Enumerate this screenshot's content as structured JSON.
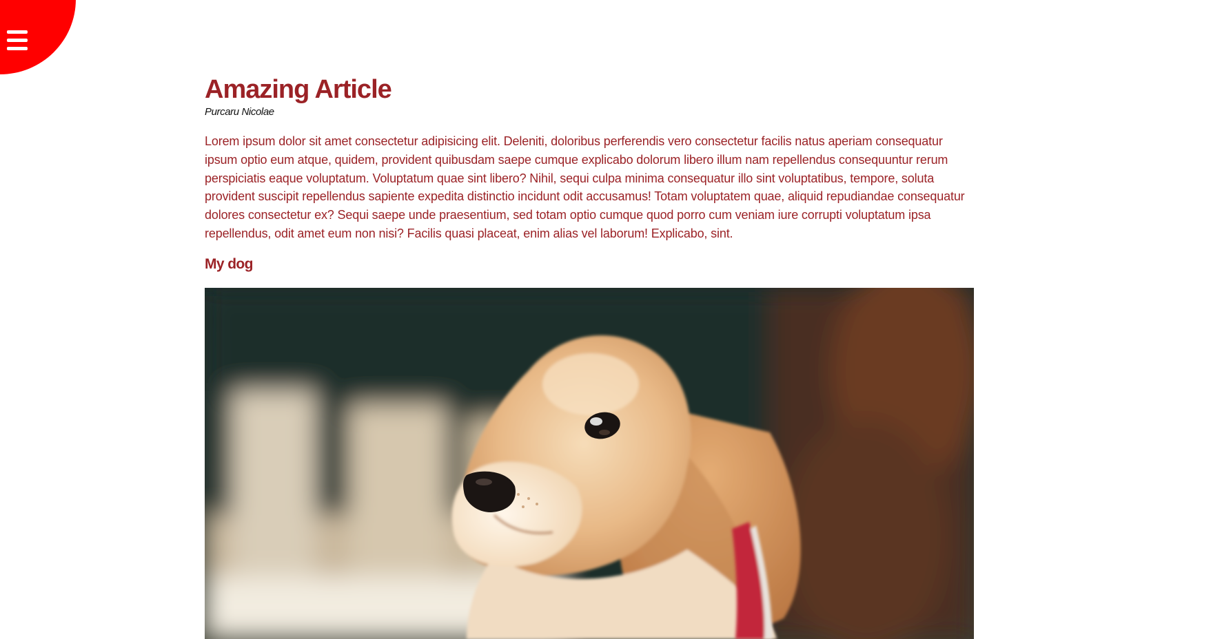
{
  "nav": {
    "menu_icon": "hamburger-menu-icon",
    "accent_color": "#ff0000"
  },
  "article": {
    "title": "Amazing Article",
    "author": "Purcaru Nicolae",
    "body": "Lorem ipsum dolor sit amet consectetur adipisicing elit. Deleniti, doloribus perferendis vero consectetur facilis natus aperiam consequatur ipsum optio eum atque, quidem, provident quibusdam saepe cumque explicabo dolorum libero illum nam repellendus consequuntur rerum perspiciatis eaque voluptatum. Voluptatum quae sint libero? Nihil, sequi culpa minima consequatur illo sint voluptatibus, tempore, soluta provident suscipit repellendus sapiente expedita distinctio incidunt odit accusamus! Totam voluptatem quae, aliquid repudiandae consequatur dolores consectetur ex? Sequi saepe unde praesentium, sed totam optio cumque quod porro cum veniam iure corrupti voluptatum ipsa repellendus, odit amet eum non nisi? Facilis quasi placeat, enim alias vel laborum! Explicabo, sint.",
    "section_heading": "My dog",
    "text_color": "#9b2226"
  }
}
